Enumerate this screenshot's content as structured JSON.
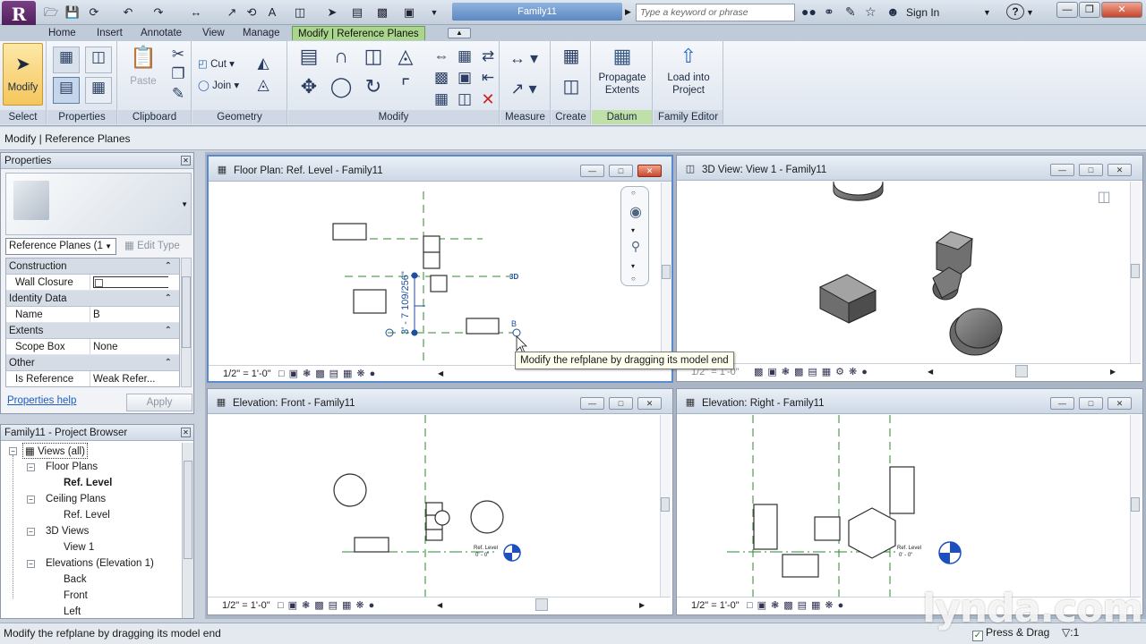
{
  "titlebar": {
    "app_menu_glyph": "R",
    "document_title": "Family11",
    "search_placeholder": "Type a keyword or phrase",
    "sign_in": "Sign In",
    "help": "?"
  },
  "ribbon_tabs": [
    "Home",
    "Insert",
    "Annotate",
    "View",
    "Manage",
    "Modify | Reference Planes"
  ],
  "ribbon": {
    "modify_label": "Modify",
    "paste_label": "Paste",
    "cut_label": "Cut",
    "join_label": "Join",
    "propagate_label_1": "Propagate",
    "propagate_label_2": "Extents",
    "load_label_1": "Load into",
    "load_label_2": "Project",
    "panels": {
      "select": "Select",
      "properties": "Properties",
      "clipboard": "Clipboard",
      "geometry": "Geometry",
      "modify": "Modify",
      "measure": "Measure",
      "create": "Create",
      "datum": "Datum",
      "family_editor": "Family Editor"
    }
  },
  "options_bar": {
    "context": "Modify | Reference Planes"
  },
  "properties": {
    "title": "Properties",
    "type_selector": "Reference Planes (1",
    "edit_type": "Edit Type",
    "groups": {
      "construction": "Construction",
      "identity": "Identity Data",
      "extents": "Extents",
      "other": "Other"
    },
    "rows": {
      "wall_closure": {
        "name": "Wall Closure",
        "value": ""
      },
      "name": {
        "name": "Name",
        "value": "B"
      },
      "scope_box": {
        "name": "Scope Box",
        "value": "None"
      },
      "is_reference": {
        "name": "Is Reference",
        "value": "Weak Refer..."
      }
    },
    "help_link": "Properties help",
    "apply": "Apply"
  },
  "project_browser": {
    "title": "Family11 - Project Browser",
    "items": {
      "views_all": "Views (all)",
      "floor_plans": "Floor Plans",
      "ref_level_fp": "Ref. Level",
      "ceiling_plans": "Ceiling Plans",
      "ref_level_cp": "Ref. Level",
      "views_3d": "3D Views",
      "view1": "View 1",
      "elevations": "Elevations (Elevation 1)",
      "back": "Back",
      "front": "Front",
      "left": "Left"
    }
  },
  "views": {
    "floor_plan": {
      "title": "Floor Plan: Ref. Level - Family11",
      "scale": "1/2\" = 1'-0\"",
      "dimension": "3' - 7 109/256\"",
      "plane_label_1": "3D",
      "plane_label_2": "B"
    },
    "view3d": {
      "title": "3D View: View 1 - Family11",
      "scale": "1/2\" = 1'-0\""
    },
    "elev_front": {
      "title": "Elevation: Front - Family11",
      "scale": "1/2\" = 1'-0\"",
      "level_name": "Ref. Level",
      "level_value": "0' - 0\""
    },
    "elev_right": {
      "title": "Elevation: Right - Family11",
      "scale": "1/2\" = 1'-0\"",
      "level_name": "Ref. Level",
      "level_value": "0' - 0\""
    }
  },
  "tooltip": "Modify the refplane by dragging its model end",
  "status": {
    "message": "Modify the refplane by dragging its model end",
    "press_drag": "Press & Drag",
    "filter_count": ":1"
  },
  "watermark": "lynda.com",
  "colors": {
    "active_tab": "#a9d68c",
    "ref_plane": "#2c8a2c",
    "dimension": "#1f4fa0",
    "level_marker": "#1d4fbf"
  }
}
